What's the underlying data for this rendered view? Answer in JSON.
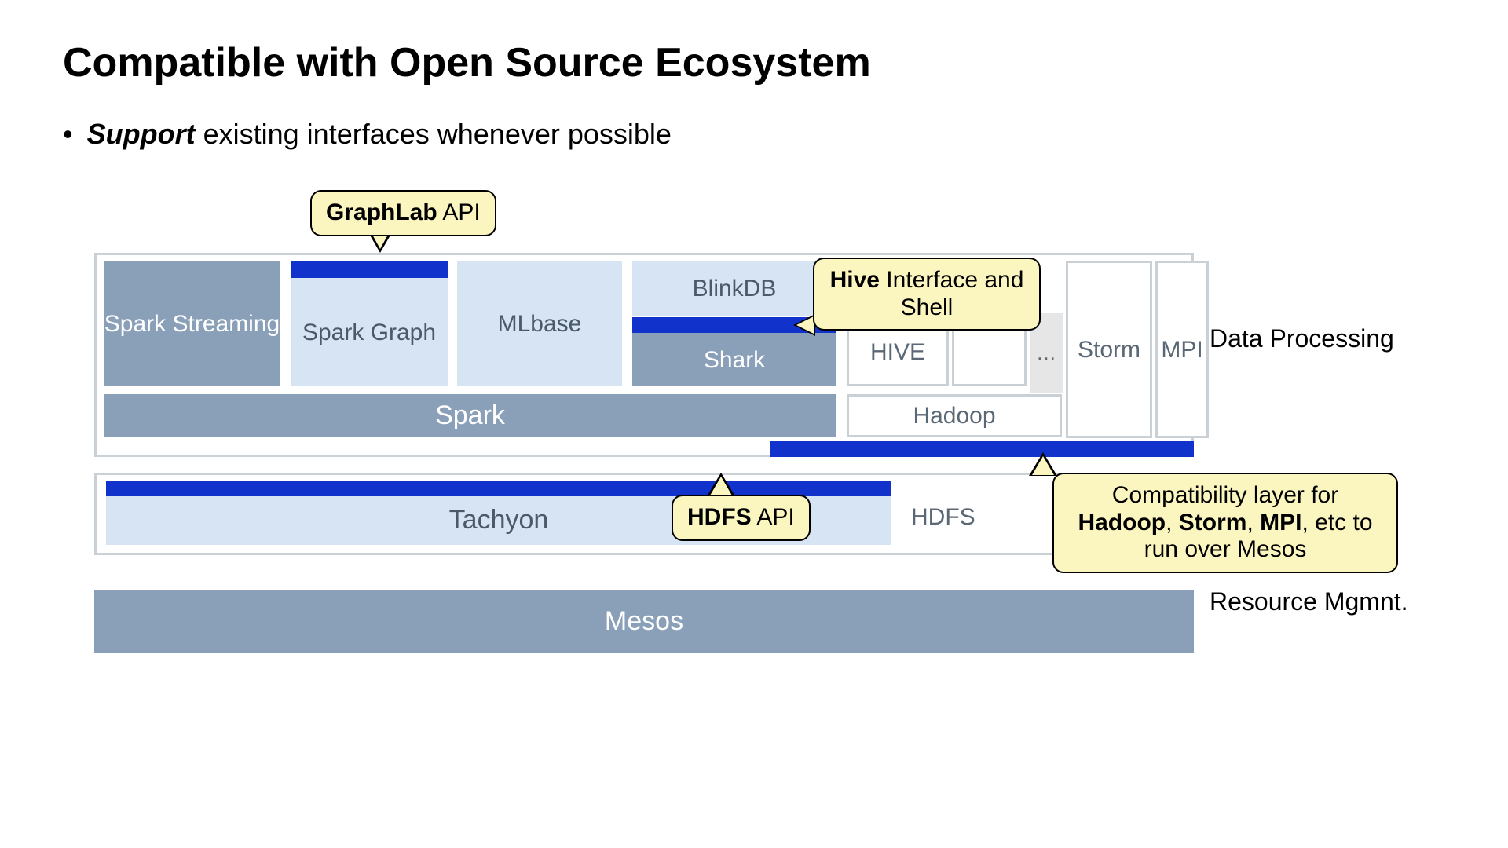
{
  "title": "Compatible with Open Source Ecosystem",
  "bullet": {
    "emph": "Support",
    "rest": " existing interfaces whenever possible"
  },
  "labels": {
    "data_processing": "Data Processing",
    "resource_mgmt": "Resource Mgmnt."
  },
  "blocks": {
    "spark_streaming": "Spark Streaming",
    "spark_graph": "Spark Graph",
    "mlbase": "MLbase",
    "blinkdb": "BlinkDB",
    "shark": "Shark",
    "hive": "HIVE",
    "ellipsis": "…",
    "storm": "Storm",
    "mpi": "MPI",
    "spark": "Spark",
    "hadoop": "Hadoop",
    "tachyon": "Tachyon",
    "hdfs": "HDFS",
    "mesos": "Mesos"
  },
  "callouts": {
    "graphlab": {
      "bold": "GraphLab",
      "rest": " API"
    },
    "hive_if": {
      "bold": "Hive",
      "rest": " Interface and Shell"
    },
    "hdfs_api": {
      "bold": "HDFS",
      "rest": " API"
    },
    "compat": {
      "pre": "Compatibility layer for ",
      "b1": "Hadoop",
      "s1": ", ",
      "b2": "Storm",
      "s2": ", ",
      "b3": "MPI",
      "post": ", etc to run over Mesos"
    }
  }
}
